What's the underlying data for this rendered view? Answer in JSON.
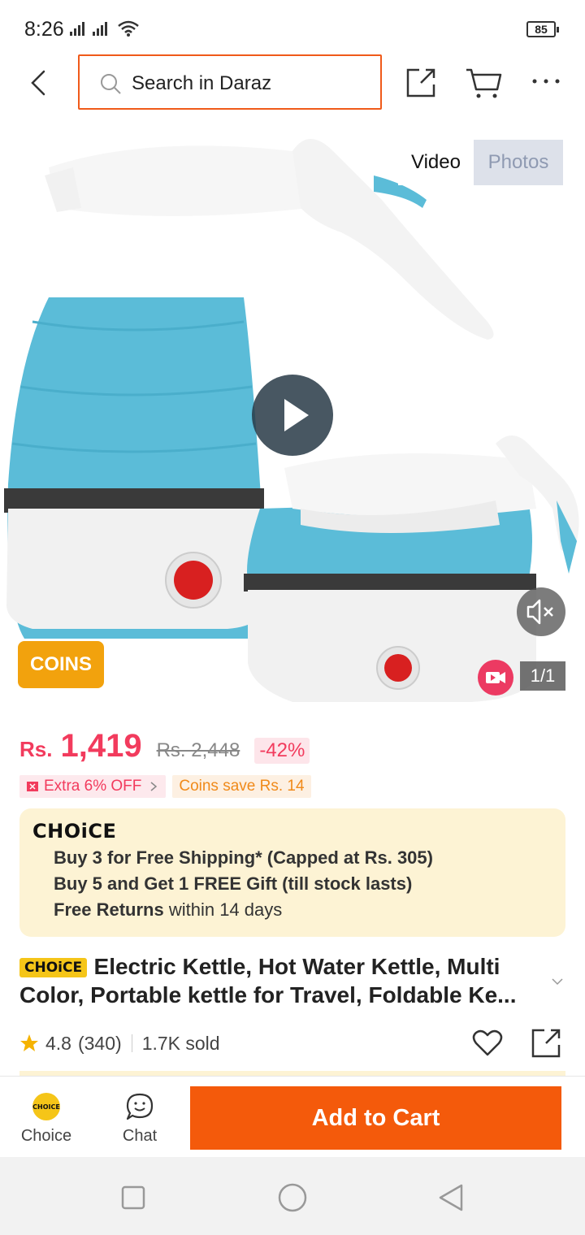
{
  "status_bar": {
    "time": "8:26",
    "battery": "85"
  },
  "top_nav": {
    "search_placeholder": "Search in Daraz"
  },
  "gallery": {
    "tabs": [
      "Video",
      "Photos"
    ],
    "active_tab": "Photos",
    "coins_badge": "COINS",
    "page_indicator": "1/1"
  },
  "price": {
    "currency": "Rs.",
    "current": "1,419",
    "original": "Rs. 2,448",
    "discount": "-42%"
  },
  "promos": {
    "extra_off": "Extra 6% OFF",
    "coins_save": "Coins save Rs. 14"
  },
  "choice": {
    "logo": "CHOiCE",
    "line1": "Buy 3 for  Free Shipping* (Capped at Rs. 305)",
    "line2": "Buy 5 and Get 1 FREE Gift (till stock lasts)",
    "line3_bold": "Free Returns",
    "line3_rest": " within 14 days"
  },
  "product": {
    "choice_tag": "CHOiCE",
    "title": "Electric Kettle, Hot Water Kettle, Multi Color, Portable kettle for Travel, Foldable Ke...",
    "rating": "4.8",
    "reviews": "(340)",
    "sold": "1.7K sold"
  },
  "action_bar": {
    "choice_label": "Choice",
    "choice_icon_text": "CHOICE",
    "chat_label": "Chat",
    "add_to_cart": "Add to Cart"
  },
  "colors": {
    "brand_orange": "#f45a0b",
    "price_red": "#f23b5d",
    "choice_yellow": "#f5c518",
    "coins_orange": "#f2a20d"
  }
}
